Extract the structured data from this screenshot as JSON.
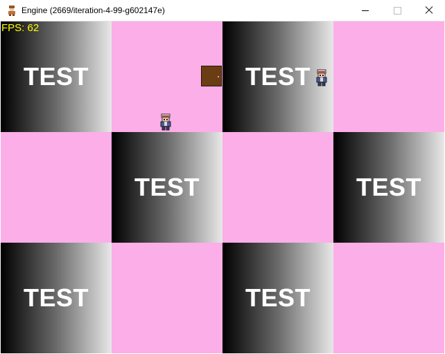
{
  "window": {
    "title": "Engine (2669/iteration-4-99-g602147e)",
    "app_icon": "character-icon",
    "controls": [
      "minimize-icon",
      "maximize-icon",
      "close-icon"
    ]
  },
  "hud": {
    "fps_text": "FPS: 62",
    "fps_color": "#ffff00"
  },
  "tiles": {
    "label": "TEST",
    "pink_color": "#fcaee8",
    "gradient": [
      "#000000",
      "#e8e8e8"
    ]
  },
  "objects": {
    "door_icon": "door-icon",
    "player_icon": "trainer-sprite-icon",
    "npc_icon": "trainer-sprite-icon"
  }
}
